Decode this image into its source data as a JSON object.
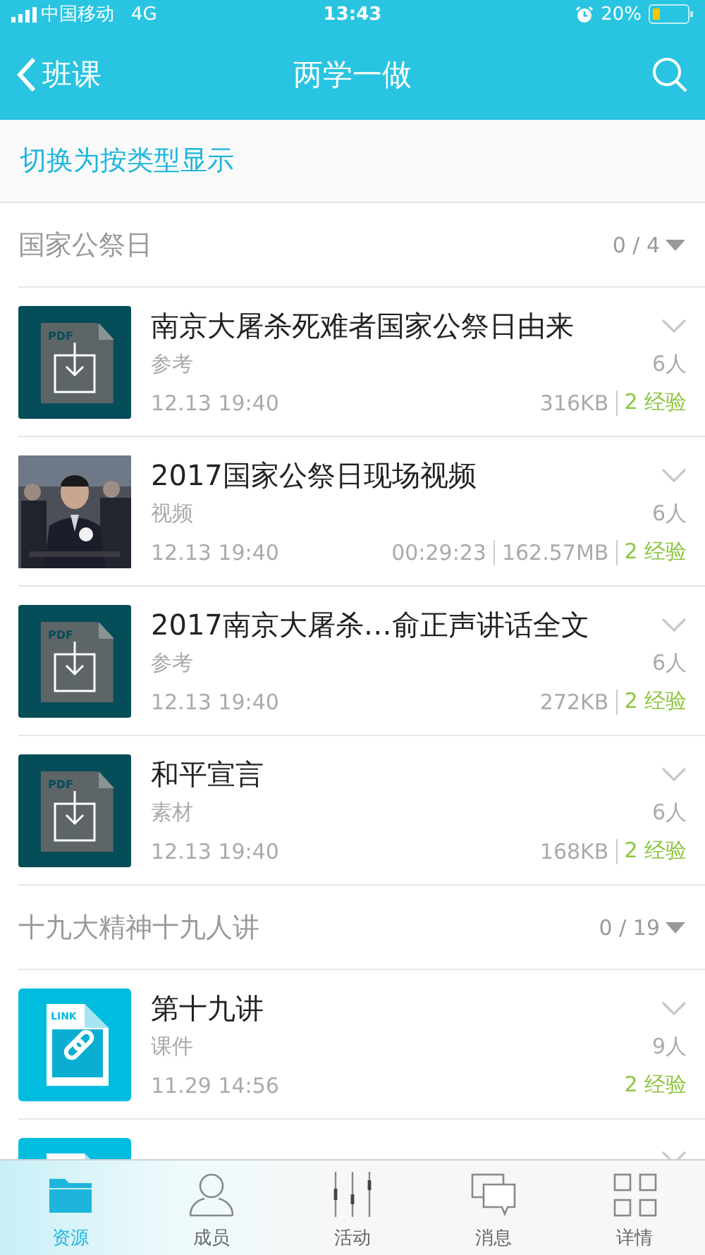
{
  "status_bar": {
    "carrier": "中国移动",
    "network": "4G",
    "time": "13:43",
    "battery": "20%"
  },
  "nav_bar": {
    "back_label": "班课",
    "title": "两学一做"
  },
  "switch_link": "切换为按类型显示",
  "groups": [
    {
      "title": "国家公祭日",
      "count": "0 / 4",
      "items": [
        {
          "kind": "pdf",
          "file_label": "PDF",
          "title": "南京大屠杀死难者国家公祭日由来",
          "type": "参考",
          "time": "12.13 19:40",
          "size": "316KB",
          "people": "6人",
          "exp": "2 经验"
        },
        {
          "kind": "video",
          "title": "2017国家公祭日现场视频",
          "type": "视频",
          "time": "12.13 19:40",
          "duration": "00:29:23",
          "size": "162.57MB",
          "people": "6人",
          "exp": "2 经验"
        },
        {
          "kind": "pdf",
          "file_label": "PDF",
          "title": "2017南京大屠杀…俞正声讲话全文",
          "type": "参考",
          "time": "12.13 19:40",
          "size": "272KB",
          "people": "6人",
          "exp": "2 经验"
        },
        {
          "kind": "pdf",
          "file_label": "PDF",
          "title": "和平宣言",
          "type": "素材",
          "time": "12.13 19:40",
          "size": "168KB",
          "people": "6人",
          "exp": "2 经验"
        }
      ]
    },
    {
      "title": "十九大精神十九人讲",
      "count": "0 / 19",
      "items": [
        {
          "kind": "link",
          "file_label": "LINK",
          "title": "第十九讲",
          "type": "课件",
          "time": "11.29 14:56",
          "people": "9人",
          "exp": "2 经验"
        },
        {
          "kind": "link"
        }
      ]
    }
  ],
  "tab_bar": [
    {
      "label": "资源",
      "selected": true
    },
    {
      "label": "成员",
      "selected": false
    },
    {
      "label": "活动",
      "selected": false
    },
    {
      "label": "消息",
      "selected": false
    },
    {
      "label": "详情",
      "selected": false
    }
  ]
}
